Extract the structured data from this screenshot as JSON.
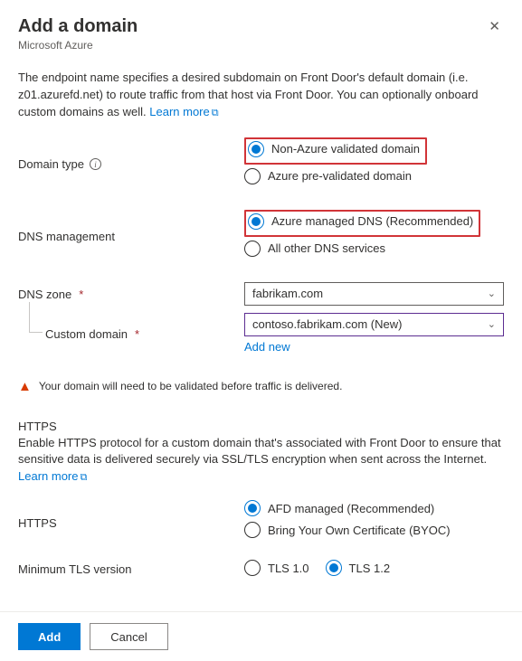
{
  "header": {
    "title": "Add a domain",
    "subtitle": "Microsoft Azure"
  },
  "description": {
    "text": "The endpoint name specifies a desired subdomain on Front Door's default domain (i.e. z01.azurefd.net) to route traffic from that host via Front Door. You can optionally onboard custom domains as well.",
    "learn_more": "Learn more"
  },
  "domain_type": {
    "label": "Domain type",
    "option1": "Non-Azure validated domain",
    "option2": "Azure pre-validated domain"
  },
  "dns_management": {
    "label": "DNS management",
    "option1": "Azure managed DNS (Recommended)",
    "option2": "All other DNS services"
  },
  "dns_zone": {
    "label": "DNS zone",
    "value": "fabrikam.com"
  },
  "custom_domain": {
    "label": "Custom domain",
    "value": "contoso.fabrikam.com (New)",
    "add_new": "Add new"
  },
  "warning": "Your domain will need to be validated before traffic is delivered.",
  "https": {
    "section_title": "HTTPS",
    "desc": "Enable HTTPS protocol for a custom domain that's associated with Front Door to ensure that sensitive data is delivered securely via SSL/TLS encryption when sent across the Internet.",
    "learn_more": "Learn more",
    "label": "HTTPS",
    "option1": "AFD managed (Recommended)",
    "option2": "Bring Your Own Certificate (BYOC)"
  },
  "tls": {
    "label": "Minimum TLS version",
    "option1": "TLS 1.0",
    "option2": "TLS 1.2"
  },
  "footer": {
    "add": "Add",
    "cancel": "Cancel"
  }
}
